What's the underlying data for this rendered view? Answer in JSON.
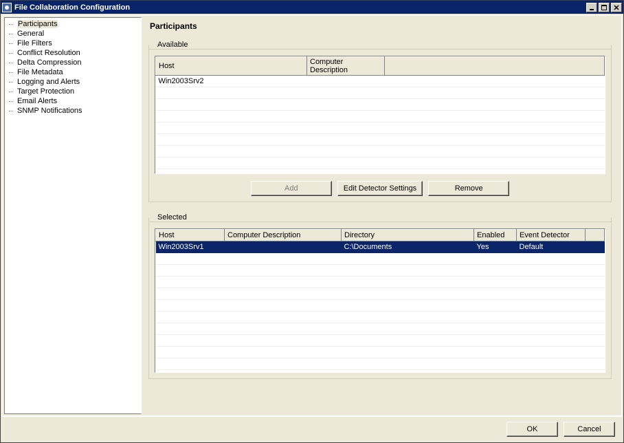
{
  "window": {
    "title": "File Collaboration Configuration"
  },
  "sidebar": {
    "items": [
      {
        "label": "Participants",
        "selected": true
      },
      {
        "label": "General"
      },
      {
        "label": "File Filters"
      },
      {
        "label": "Conflict Resolution"
      },
      {
        "label": "Delta Compression"
      },
      {
        "label": "File Metadata"
      },
      {
        "label": "Logging and Alerts"
      },
      {
        "label": "Target Protection"
      },
      {
        "label": "Email Alerts"
      },
      {
        "label": "SNMP Notifications"
      }
    ]
  },
  "main": {
    "heading": "Participants",
    "available": {
      "legend": "Available",
      "columns": [
        "Host",
        "Computer Description",
        ""
      ],
      "rows": [
        {
          "host": "Win2003Srv2",
          "desc": ""
        }
      ]
    },
    "buttons": {
      "add": "Add",
      "edit": "Edit Detector Settings",
      "remove": "Remove"
    },
    "selected": {
      "legend": "Selected",
      "columns": [
        "Host",
        "Computer Description",
        "Directory",
        "Enabled",
        "Event Detector",
        ""
      ],
      "rows": [
        {
          "host": "Win2003Srv1",
          "desc": "",
          "dir": "C:\\Documents",
          "enabled": "Yes",
          "detector": "Default",
          "selected": true
        }
      ]
    }
  },
  "footer": {
    "ok": "OK",
    "cancel": "Cancel"
  }
}
